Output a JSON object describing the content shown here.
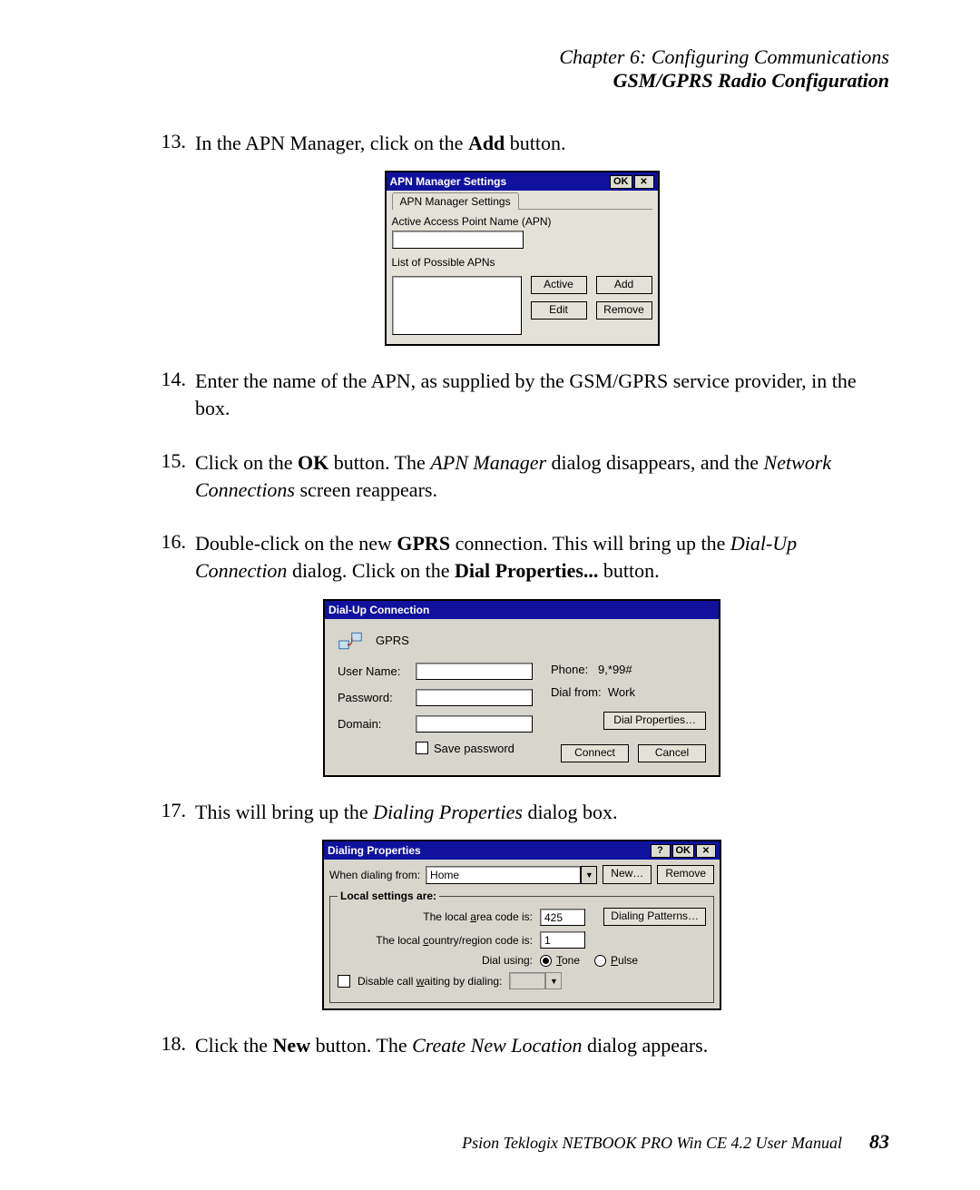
{
  "header": {
    "chapter": "Chapter 6:  Configuring Communications",
    "section": "GSM/GPRS Radio Configuration"
  },
  "steps": {
    "s13": {
      "num": "13.",
      "prefix": "In the APN Manager, click on the ",
      "bold1": "Add",
      "suffix": " button."
    },
    "s14": {
      "num": "14.",
      "text": "Enter the name of the APN, as supplied by the GSM/GPRS service provider, in the box."
    },
    "s15": {
      "num": "15.",
      "p1": "Click on the ",
      "b1": "OK",
      "p2": " button. The ",
      "i1": "APN Manager",
      "p3": " dialog disappears, and the ",
      "i2": "Network Connections",
      "p4": " screen reappears."
    },
    "s16": {
      "num": "16.",
      "p1": "Double-click on the new ",
      "b1": "GPRS",
      "p2": " connection. This will bring up the ",
      "i1": "Dial-Up Connection",
      "p3": " dialog. Click on the ",
      "b2": "Dial Properties...",
      "p4": " button."
    },
    "s17": {
      "num": "17.",
      "p1": "This will bring up the ",
      "i1": "Dialing Properties",
      "p2": " dialog box."
    },
    "s18": {
      "num": "18.",
      "p1": "Click the ",
      "b1": "New",
      "p2": " button. The ",
      "i1": "Create New Location",
      "p3": " dialog appears."
    }
  },
  "apn": {
    "title": "APN Manager Settings",
    "ok": "OK",
    "tab": "APN Manager Settings",
    "active_label": "Active Access Point Name (APN)",
    "list_label": "List of Possible APNs",
    "btn_active": "Active",
    "btn_add": "Add",
    "btn_edit": "Edit",
    "btn_remove": "Remove"
  },
  "dial": {
    "title": "Dial-Up Connection",
    "conn_name": "GPRS",
    "user_label": "User Name:",
    "pass_label": "Password:",
    "domain_label": "Domain:",
    "savepw": "Save password",
    "phone_label": "Phone:",
    "phone_value": "9,*99#",
    "from_label": "Dial from:",
    "from_value": "Work",
    "btn_dp": "Dial Properties…",
    "btn_connect": "Connect",
    "btn_cancel": "Cancel"
  },
  "dp": {
    "title": "Dialing Properties",
    "ok": "OK",
    "help": "?",
    "when_label": "When dialing from:",
    "when_value": "Home",
    "btn_new": "New…",
    "btn_remove": "Remove",
    "legend": "Local settings are:",
    "area_label": "The local area code is:",
    "area_value": "425",
    "country_label": "The local country/region code is:",
    "country_value": "1",
    "dial_label": "Dial using:",
    "tone": "Tone",
    "pulse": "Pulse",
    "disable_label": "Disable call waiting by dialing:",
    "btn_patterns": "Dialing Patterns…"
  },
  "footer": {
    "text": "Psion Teklogix NETBOOK PRO Win CE 4.2 User Manual",
    "page": "83"
  }
}
